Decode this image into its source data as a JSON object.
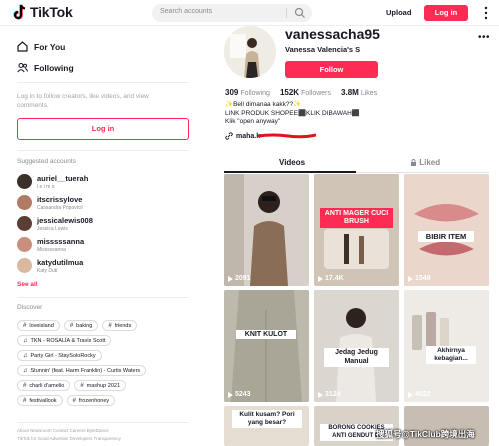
{
  "header": {
    "logo_text": "TikTok",
    "search_placeholder": "Search accounts",
    "upload_label": "Upload",
    "login_label": "Log in"
  },
  "sidebar": {
    "nav": [
      {
        "label": "For You",
        "icon": "home-icon"
      },
      {
        "label": "Following",
        "icon": "people-icon"
      }
    ],
    "login_hint": "Log in to follow creators, like videos, and view comments.",
    "login_button": "Log in",
    "suggested_title": "Suggested accounts",
    "accounts": [
      {
        "user": "auriel__tuerah",
        "name": "l e i m o"
      },
      {
        "user": "itscrissylove",
        "name": "Cassandra Popovicii"
      },
      {
        "user": "jessicalewis008",
        "name": "Jessica Lewis"
      },
      {
        "user": "misssssanna",
        "name": "Misssssanna"
      },
      {
        "user": "katydutilmua",
        "name": "Katy Duti"
      }
    ],
    "see_all": "See all",
    "discover_title": "Discover",
    "tags": [
      [
        {
          "icon": "#",
          "label": "loveisland"
        },
        {
          "icon": "#",
          "label": "baking"
        },
        {
          "icon": "#",
          "label": "friends"
        }
      ],
      [
        {
          "icon": "♫",
          "label": "TKN - ROSALÍA & Travis Scott"
        }
      ],
      [
        {
          "icon": "♫",
          "label": "Party Girl - StaySoloRocky"
        }
      ],
      [
        {
          "icon": "♫",
          "label": "Stunnin' (feat. Harm Franklin) - Curtis Waters"
        }
      ],
      [
        {
          "icon": "#",
          "label": "charli d'amelio"
        },
        {
          "icon": "#",
          "label": "mashup 2021"
        }
      ],
      [
        {
          "icon": "#",
          "label": "festivallook"
        },
        {
          "icon": "#",
          "label": "frozenhoney"
        }
      ]
    ],
    "footer_line1": "About  Newsroom  Contact  Careers  ByteDance",
    "footer_line2": "TikTok for Good  Advertise  Developers  Transparency"
  },
  "profile": {
    "username": "vanessacha95",
    "nickname": "Vanessa Valencia's S",
    "follow_label": "Follow",
    "stats": [
      {
        "value": "309",
        "label": "Following"
      },
      {
        "value": "152K",
        "label": "Followers"
      },
      {
        "value": "3.8M",
        "label": "Likes"
      }
    ],
    "bio_line1": "✨Bell dimanaa kakk??✨",
    "bio_line2": "LINK PRODUK SHOPEE⬛KLIK DIBAWAH⬛",
    "bio_line3": "Klik \"open anyway\"",
    "link_text": "maha.k",
    "tab_videos": "Videos",
    "tab_liked": "Liked"
  },
  "videos": [
    {
      "views": "2091",
      "caption": "",
      "bg": "#cfc7bf"
    },
    {
      "views": "17.4K",
      "caption": "ANTI MAGER CUCI BRUSH",
      "bg": "#c9bfb3"
    },
    {
      "views": "1549",
      "caption": "BIBIR ITEM",
      "bg": "#e6cfc4"
    },
    {
      "views": "5243",
      "caption": "KNIT KULOT",
      "bg": "#b9b6aa"
    },
    {
      "views": "3124",
      "caption": "Jedag Jedug Manual",
      "bg": "#d8d2cc"
    },
    {
      "views": "4022",
      "caption": "Akhirnya kebagian...",
      "bg": "#ece8e2"
    },
    {
      "views": "",
      "caption": "Kulit kusam? Pori yang besar?",
      "bg": "#e6ddd2"
    },
    {
      "views": "",
      "caption": "BORONG COOKIES ANTI GENDUT DI",
      "bg": "#d9d2c8"
    },
    {
      "views": "",
      "caption": "",
      "bg": "#c7bdb2"
    }
  ],
  "watermark": "搜狐号@TikClub跨境出海",
  "colors": {
    "accent": "#fe2c55",
    "text": "#161823",
    "muted": "#8a8b91"
  }
}
